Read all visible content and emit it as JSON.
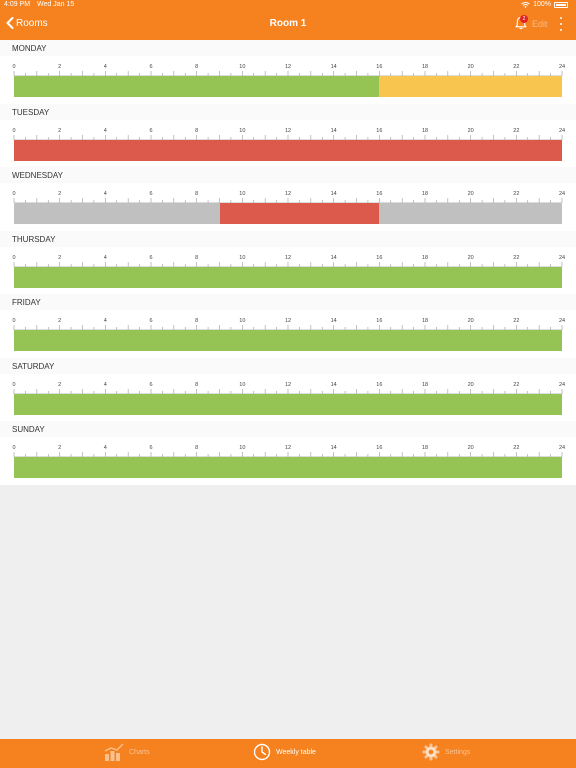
{
  "status_bar": {
    "time": "4:09 PM",
    "date": "Wed Jan 15",
    "battery": "100%"
  },
  "nav": {
    "back_label": "Rooms",
    "title": "Room 1",
    "notification_count": "2",
    "edit_label": "Edit"
  },
  "axis": {
    "ticks": [
      "0",
      "2",
      "4",
      "6",
      "8",
      "10",
      "12",
      "14",
      "16",
      "18",
      "20",
      "22",
      "24"
    ]
  },
  "colors": {
    "green": "#95c354",
    "yellow": "#f8c64e",
    "red": "#dc5a4b",
    "gray": "#c0c0c0",
    "accent": "#f5821f"
  },
  "days": [
    {
      "name": "MONDAY",
      "segments": [
        {
          "start": 0,
          "end": 16,
          "color": "green"
        },
        {
          "start": 16,
          "end": 24,
          "color": "yellow"
        }
      ]
    },
    {
      "name": "TUESDAY",
      "segments": [
        {
          "start": 0,
          "end": 24,
          "color": "red"
        }
      ]
    },
    {
      "name": "WEDNESDAY",
      "segments": [
        {
          "start": 0,
          "end": 9,
          "color": "gray"
        },
        {
          "start": 9,
          "end": 16,
          "color": "red"
        },
        {
          "start": 16,
          "end": 24,
          "color": "gray"
        }
      ]
    },
    {
      "name": "THURSDAY",
      "segments": [
        {
          "start": 0,
          "end": 24,
          "color": "green"
        }
      ]
    },
    {
      "name": "FRIDAY",
      "segments": [
        {
          "start": 0,
          "end": 24,
          "color": "green"
        }
      ]
    },
    {
      "name": "SATURDAY",
      "segments": [
        {
          "start": 0,
          "end": 24,
          "color": "green"
        }
      ]
    },
    {
      "name": "SUNDAY",
      "segments": [
        {
          "start": 0,
          "end": 24,
          "color": "green"
        }
      ]
    }
  ],
  "tabs": [
    {
      "label": "Charts",
      "icon": "bar-chart-icon",
      "active": false
    },
    {
      "label": "Weekly table",
      "icon": "clock-icon",
      "active": true
    },
    {
      "label": "Settings",
      "icon": "gear-icon",
      "active": false
    }
  ]
}
